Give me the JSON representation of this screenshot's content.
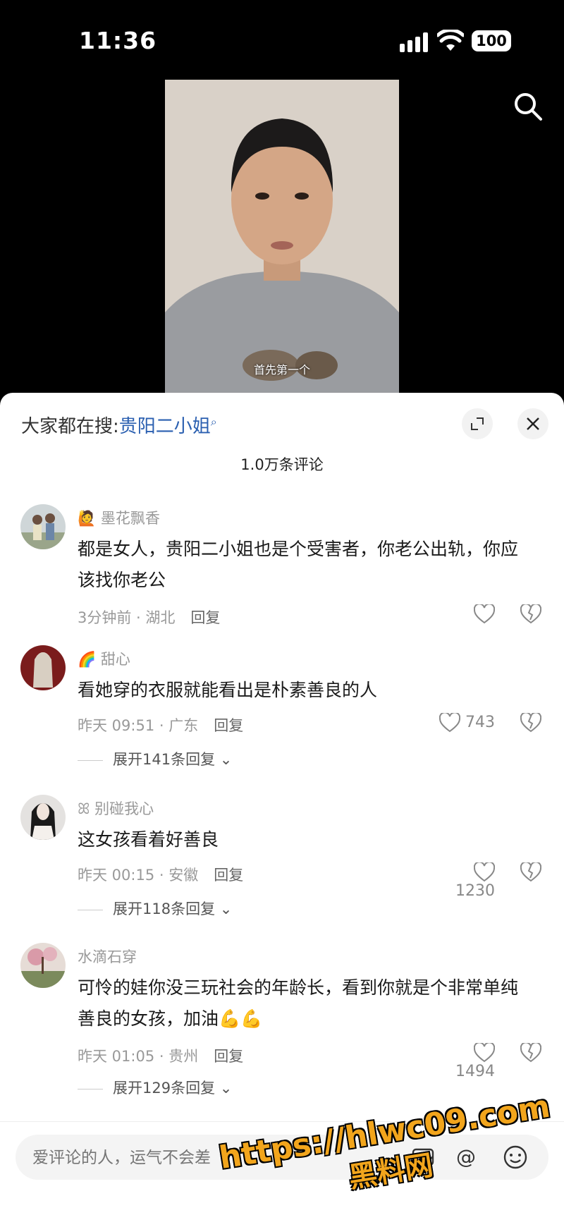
{
  "status_bar": {
    "time": "11:36",
    "battery": "100"
  },
  "video": {
    "subtitle": "首先第一个"
  },
  "comments_panel": {
    "trending_prefix": "大家都在搜:",
    "trending_link": "贵阳二小姐",
    "count": "1.0万条评论",
    "comments": [
      {
        "user": "墨花飘香",
        "text": "都是女人，贵阳二小姐也是个受害者，你老公出轨，你应该找你老公",
        "time_location": "3分钟前 · 湖北",
        "reply_label": "回复",
        "likes": ""
      },
      {
        "user": "甜心",
        "text": "看她穿的衣服就能看出是朴素善良的人",
        "time_location": "昨天 09:51 · 广东",
        "reply_label": "回复",
        "likes": "743",
        "expand": "展开141条回复"
      },
      {
        "user": "别碰我心",
        "text": "这女孩看着好善良",
        "time_location": "昨天 00:15 · 安徽",
        "reply_label": "回复",
        "likes": "1230",
        "expand": "展开118条回复"
      },
      {
        "user": "水滴石穿",
        "text": "可怜的娃你没三玩社会的年龄长，看到你就是个非常单纯善良的女孩，加油💪💪",
        "time_location": "昨天 01:05 · 贵州",
        "reply_label": "回复",
        "likes": "1494",
        "expand": "展开129条回复"
      }
    ]
  },
  "input": {
    "placeholder": "爱评论的人，运气不会差"
  },
  "watermark": {
    "line1": "https://hlwc09.com",
    "line2": "黑料网"
  }
}
